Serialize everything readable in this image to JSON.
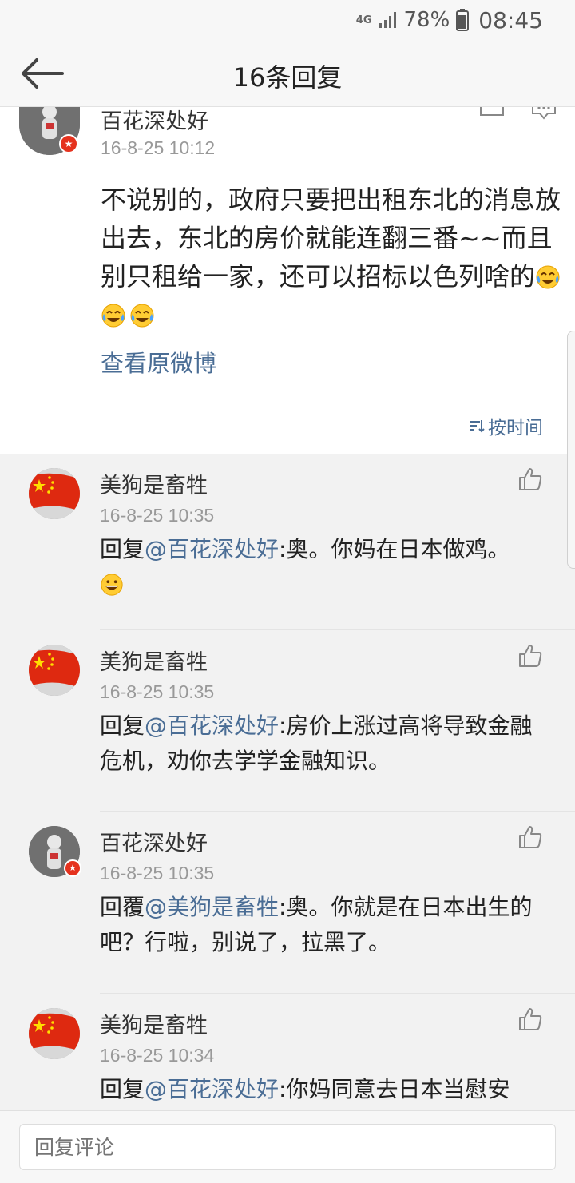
{
  "status_bar": {
    "network": "4G",
    "signal_icon": "signal-bars-icon",
    "battery_percent": "78%",
    "battery_icon": "battery-icon",
    "time": "08:45"
  },
  "header": {
    "title": "16条回复",
    "back_icon": "back-arrow-icon"
  },
  "post": {
    "username": "百花深处好",
    "time": "16-8-25 10:12",
    "text": "不说别的，政府只要把出租东北的消息放出去，东北的房价就能连翻三番~~而且别只租给一家，还可以招标以色列啥的",
    "emoji": "tears-of-joy-emoji",
    "view_original": "查看原微博",
    "sort_label": "按时间"
  },
  "comments": [
    {
      "username": "美狗是畜牲",
      "time": "16-8-25 10:35",
      "prefix": "回复",
      "mention": "@百花深处好",
      "text": ":奥。你妈在日本做鸡。",
      "avatar": "china-flag"
    },
    {
      "username": "美狗是畜牲",
      "time": "16-8-25 10:35",
      "prefix": "回复",
      "mention": "@百花深处好",
      "text": ":房价上涨过高将导致金融危机，劝你去学学金融知识。",
      "avatar": "china-flag"
    },
    {
      "username": "百花深处好",
      "time": "16-8-25 10:35",
      "prefix": "回覆",
      "mention": "@美狗是畜牲",
      "text": ":奥。你就是在日本出生的吧？行啦，别说了，拉黑了。",
      "avatar": "astronaut-bear"
    },
    {
      "username": "美狗是畜牲",
      "time": "16-8-25 10:34",
      "prefix": "回复",
      "mention": "@百花深处好",
      "text": ":你妈同意去日本当慰安",
      "avatar": "china-flag"
    }
  ],
  "footer": {
    "placeholder": "回复评论"
  },
  "colors": {
    "link": "#4a6d95",
    "badge": "#e5321e",
    "background": "#f2f2f2"
  }
}
